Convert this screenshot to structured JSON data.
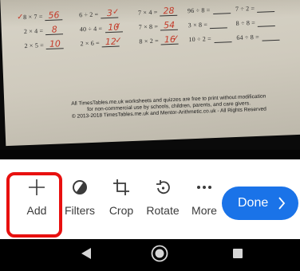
{
  "worksheet": {
    "rows": [
      [
        {
          "q": "8 × 7 =",
          "a": "56"
        },
        {
          "q": "6 ÷ 2 =",
          "a": "3"
        },
        {
          "q": "7 × 4 =",
          "a": "28"
        },
        {
          "q": "96 ÷ 8 =",
          "a": ""
        },
        {
          "q": "7 ÷ 2 =",
          "a": ""
        }
      ],
      [
        {
          "q": "2 × 4 =",
          "a": "8"
        },
        {
          "q": "40 ÷ 4 =",
          "a": "10"
        },
        {
          "q": "7 × 8 =",
          "a": "54"
        },
        {
          "q": "3 × 8 =",
          "a": ""
        },
        {
          "q": "8 ÷ 8 =",
          "a": ""
        }
      ],
      [
        {
          "q": "2 × 5 =",
          "a": "10"
        },
        {
          "q": "2 × 6 =",
          "a": "12"
        },
        {
          "q": "8 × 2 =",
          "a": "16"
        },
        {
          "q": "10 ÷ 2 =",
          "a": ""
        },
        {
          "q": "64 ÷ 8 =",
          "a": ""
        }
      ]
    ],
    "footer_line1": "All TimesTables.me.uk worksheets and quizzes are free to print without modification",
    "footer_line2": "for non-commercial use by schools, children, parents, and care givers.",
    "footer_line3": "© 2013-2018 TimesTables.me.uk and Mentor-Arithmetic.co.uk - All Rights Reserved"
  },
  "toolbar": {
    "add_label": "Add",
    "filters_label": "Filters",
    "crop_label": "Crop",
    "rotate_label": "Rotate",
    "more_label": "More",
    "done_label": "Done"
  },
  "icons": {
    "add": "plus-icon",
    "filters": "filters-icon",
    "crop": "crop-icon",
    "rotate": "rotate-icon",
    "more": "more-dots-icon",
    "done": "chevron-right-icon",
    "nav_back": "back-triangle-icon",
    "nav_home": "home-circle-icon",
    "nav_recent": "recents-square-icon"
  },
  "colors": {
    "accent": "#1a73e8",
    "highlight": "#e8100f",
    "toolbar_bg": "#ffffff",
    "label": "#3b3b3b"
  }
}
